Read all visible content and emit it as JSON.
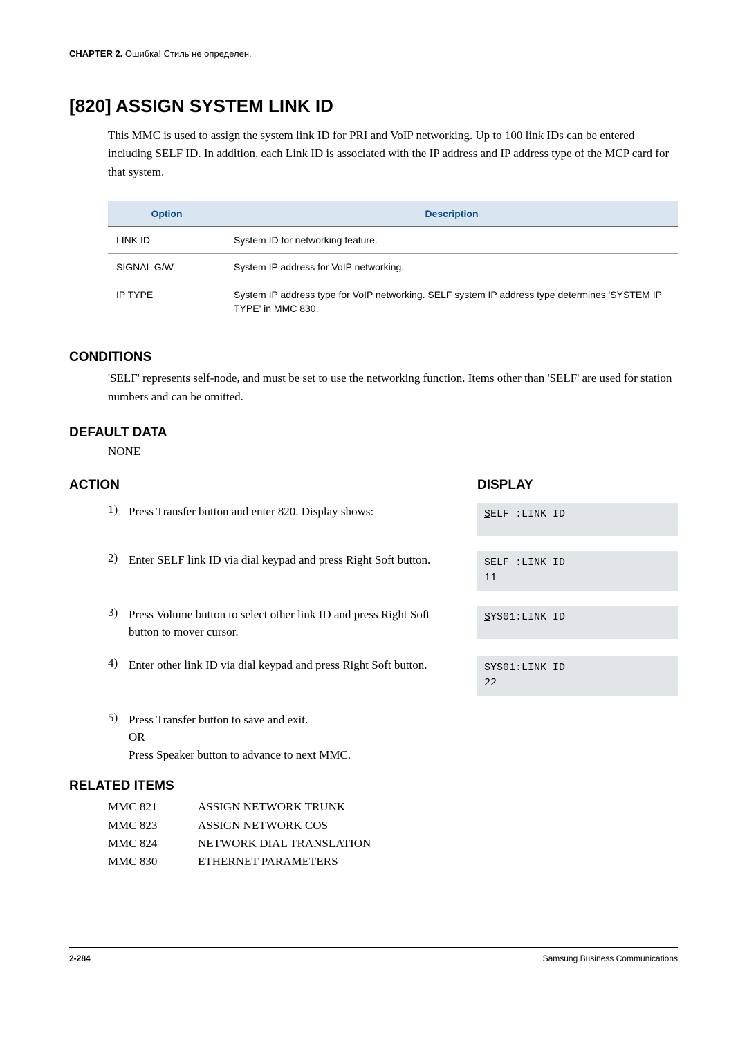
{
  "header": {
    "chapter": "CHAPTER 2.",
    "rest": " Ошибка! Стиль не определен."
  },
  "title": "[820] ASSIGN SYSTEM LINK ID",
  "intro": "This MMC is used to assign the system link ID for PRI and VoIP networking. Up to 100 link IDs can be entered including SELF ID. In addition, each Link ID is associated with the IP address and IP address type of the MCP card for that system.",
  "table": {
    "headers": {
      "option": "Option",
      "description": "Description"
    },
    "rows": [
      {
        "opt": "LINK ID",
        "desc": "System ID for networking feature."
      },
      {
        "opt": "SIGNAL G/W",
        "desc": "System IP address for VoIP networking."
      },
      {
        "opt": "IP TYPE",
        "desc": "System IP address type for VoIP networking. SELF system IP address type determines 'SYSTEM IP TYPE' in MMC 830."
      }
    ]
  },
  "sections": {
    "conditions": "CONDITIONS",
    "conditions_text": "'SELF' represents self-node, and must be set to use the networking function. Items other than 'SELF' are used for station numbers and can be omitted.",
    "default_data": "DEFAULT DATA",
    "default_text": "NONE",
    "action": "ACTION",
    "display": "DISPLAY",
    "related": "RELATED ITEMS"
  },
  "steps": [
    {
      "num": "1)",
      "text": "Press Transfer button and enter 820. Display shows:",
      "display_u": "S",
      "display_rest": "ELF :LINK ID",
      "display_line2": ""
    },
    {
      "num": "2)",
      "text": "Enter SELF link ID via dial keypad and press Right Soft button.",
      "display_u": "",
      "display_rest": "SELF :LINK ID",
      "display_line2": "11"
    },
    {
      "num": "3)",
      "text": "Press Volume button to select other link ID and press Right Soft button to mover cursor.",
      "display_u": "S",
      "display_rest": "YS01:LINK ID",
      "display_line2": ""
    },
    {
      "num": "4)",
      "text": "Enter other link ID via dial keypad and press Right Soft button.",
      "display_u": "S",
      "display_rest": "YS01:LINK ID",
      "display_line2": "22"
    }
  ],
  "step5": {
    "num": "5)",
    "line1": "Press Transfer button to save and exit.",
    "line2": "OR",
    "line3": "Press Speaker button to advance to next MMC."
  },
  "related_items": [
    {
      "code": "MMC 821",
      "name": "ASSIGN NETWORK TRUNK"
    },
    {
      "code": "MMC 823",
      "name": "ASSIGN NETWORK COS"
    },
    {
      "code": "MMC 824",
      "name": "NETWORK DIAL TRANSLATION"
    },
    {
      "code": "MMC 830",
      "name": "ETHERNET PARAMETERS"
    }
  ],
  "footer": {
    "left": "2-284",
    "right": "Samsung Business Communications"
  }
}
